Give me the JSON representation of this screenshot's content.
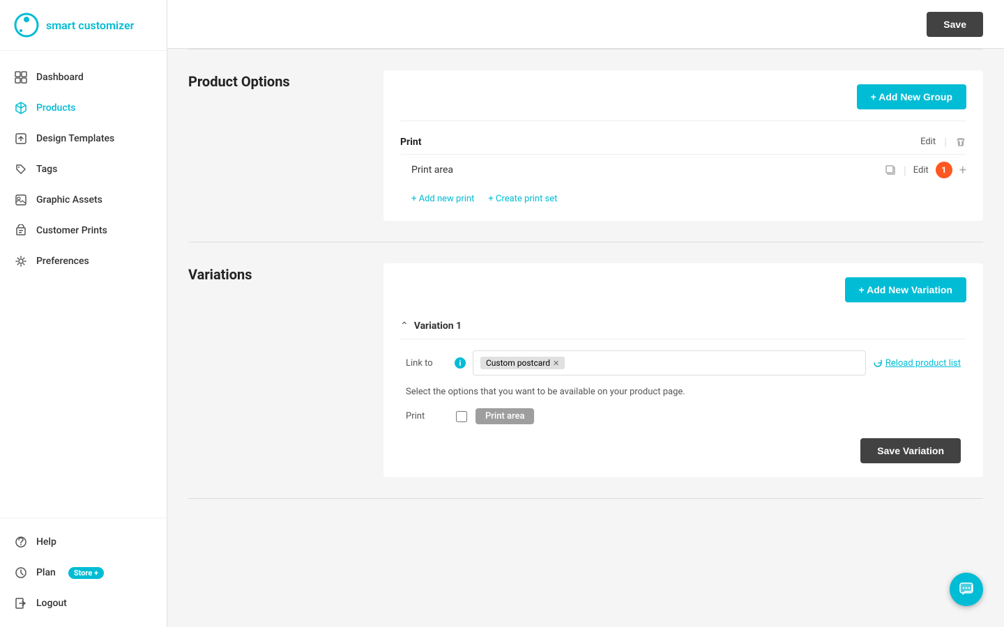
{
  "brand": {
    "logo_text": "smart customizer"
  },
  "sidebar": {
    "items": [
      {
        "id": "dashboard",
        "label": "Dashboard",
        "active": false
      },
      {
        "id": "products",
        "label": "Products",
        "active": true
      },
      {
        "id": "design-templates",
        "label": "Design Templates",
        "active": false
      },
      {
        "id": "tags",
        "label": "Tags",
        "active": false
      },
      {
        "id": "graphic-assets",
        "label": "Graphic Assets",
        "active": false
      },
      {
        "id": "customer-prints",
        "label": "Customer Prints",
        "active": false
      },
      {
        "id": "preferences",
        "label": "Preferences",
        "active": false
      }
    ],
    "bottom_items": [
      {
        "id": "help",
        "label": "Help"
      },
      {
        "id": "plan",
        "label": "Plan",
        "badge": "Store +"
      },
      {
        "id": "logout",
        "label": "Logout"
      }
    ]
  },
  "topbar": {
    "save_label": "Save"
  },
  "product_options": {
    "section_label": "Product Options",
    "add_group_label": "+ Add New Group",
    "print_group": {
      "title": "Print",
      "edit_label": "Edit",
      "print_area": {
        "name": "Print area",
        "edit_label": "Edit",
        "count": "1",
        "add_print_label": "+ Add new print",
        "create_print_set_label": "+ Create print set"
      }
    }
  },
  "variations": {
    "section_label": "Variations",
    "add_variation_label": "+ Add New Variation",
    "variation1": {
      "title": "Variation 1",
      "link_to_label": "Link to",
      "info_icon": "i",
      "tag": "Custom postcard",
      "reload_label": "Reload product list",
      "options_text": "Select the options that you want to be available on your product page.",
      "print_label": "Print",
      "print_area_badge": "Print area",
      "save_label": "Save Variation"
    }
  }
}
